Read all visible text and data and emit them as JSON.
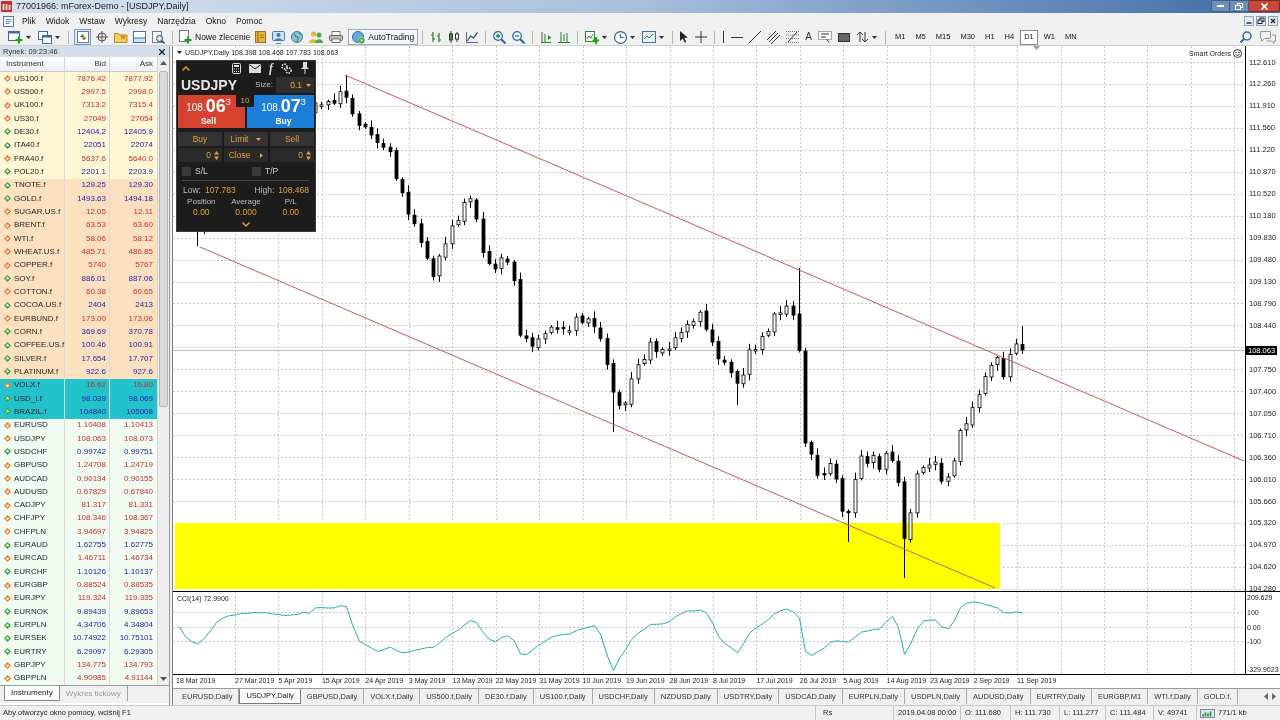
{
  "window": {
    "title": "77001966: mForex-Demo - [USDJPY,Daily]"
  },
  "menu": [
    "Plik",
    "Widok",
    "Wstaw",
    "Wykresy",
    "Narzędzia",
    "Okno",
    "Pomoc"
  ],
  "toolbar": {
    "view_toggles": [
      {
        "on": true
      },
      {
        "on": false
      },
      {
        "on": false
      },
      {
        "on": false
      },
      {
        "on": false
      }
    ],
    "new_order": "Nowe zlecenie",
    "autotrading": "AutoTrading",
    "text_tool": "A",
    "timeframes": [
      {
        "label": "M1",
        "selected": false
      },
      {
        "label": "M5",
        "selected": false
      },
      {
        "label": "M15",
        "selected": false
      },
      {
        "label": "M30",
        "selected": false
      },
      {
        "label": "H1",
        "selected": false
      },
      {
        "label": "H4",
        "selected": false
      },
      {
        "label": "D1",
        "selected": true
      },
      {
        "label": "W1",
        "selected": false
      },
      {
        "label": "MN",
        "selected": false
      }
    ]
  },
  "market_watch": {
    "title": "Rynek: 09:23:46",
    "columns": [
      "Instrument",
      "Bid",
      "Ask"
    ],
    "groups": [
      {
        "color": "#fff6d6",
        "rows": [
          {
            "symbol": "US100.f",
            "bid": "7876.42",
            "ask": "7877.92",
            "rising": false
          },
          {
            "symbol": "US500.f",
            "bid": "2997.5",
            "ask": "2998.0",
            "rising": false
          },
          {
            "symbol": "UK100.f",
            "bid": "7313.2",
            "ask": "7315.4",
            "rising": false
          },
          {
            "symbol": "US30.f",
            "bid": "27049",
            "ask": "27054",
            "rising": false
          },
          {
            "symbol": "DE30.f",
            "bid": "12404.2",
            "ask": "12405.9",
            "rising": true
          },
          {
            "symbol": "ITA40.f",
            "bid": "22051",
            "ask": "22074",
            "rising": true
          },
          {
            "symbol": "FRA40.f",
            "bid": "5637.6",
            "ask": "5640.0",
            "rising": false
          },
          {
            "symbol": "POL20.f",
            "bid": "2201.1",
            "ask": "2203.9",
            "rising": true
          }
        ]
      },
      {
        "color": "#fde0bf",
        "rows": [
          {
            "symbol": "TNOTE.f",
            "bid": "129.25",
            "ask": "129.30",
            "rising": true
          },
          {
            "symbol": "GOLD.f",
            "bid": "1493.63",
            "ask": "1494.18",
            "rising": true
          },
          {
            "symbol": "SUGAR.US.f",
            "bid": "12.05",
            "ask": "12.11",
            "rising": false
          },
          {
            "symbol": "BRENT.f",
            "bid": "63.53",
            "ask": "63.60",
            "rising": false
          },
          {
            "symbol": "WTI.f",
            "bid": "58.06",
            "ask": "58.12",
            "rising": false
          },
          {
            "symbol": "WHEAT.US.f",
            "bid": "485.71",
            "ask": "486.85",
            "rising": false
          },
          {
            "symbol": "COPPER.f",
            "bid": "5740",
            "ask": "5767",
            "rising": false
          },
          {
            "symbol": "SOY.f",
            "bid": "886.01",
            "ask": "887.06",
            "rising": true
          },
          {
            "symbol": "COTTON.f",
            "bid": "60.38",
            "ask": "60.65",
            "rising": false
          },
          {
            "symbol": "COCOA.US.f",
            "bid": "2404",
            "ask": "2413",
            "rising": true
          },
          {
            "symbol": "EURBUND.f",
            "bid": "173.00",
            "ask": "173.06",
            "rising": false
          },
          {
            "symbol": "CORN.f",
            "bid": "369.69",
            "ask": "370.78",
            "rising": true
          },
          {
            "symbol": "COFFEE.US.f",
            "bid": "100.46",
            "ask": "100.91",
            "rising": true
          },
          {
            "symbol": "SILVER.f",
            "bid": "17.654",
            "ask": "17.707",
            "rising": true
          },
          {
            "symbol": "PLATINUM.f",
            "bid": "922.6",
            "ask": "927.6",
            "rising": true
          }
        ]
      },
      {
        "color": "#22c3cb",
        "rows": [
          {
            "symbol": "VOLX.f",
            "bid": "16.62",
            "ask": "16.80",
            "rising": false
          },
          {
            "symbol": "USD_I.f",
            "bid": "98.039",
            "ask": "98.069",
            "rising": true
          },
          {
            "symbol": "BRAZIL.f",
            "bid": "104840",
            "ask": "105008",
            "rising": true
          }
        ]
      },
      {
        "color": "#f1fbf1",
        "rows": [
          {
            "symbol": "EURUSD",
            "bid": "1.10408",
            "ask": "1.10413",
            "rising": false
          },
          {
            "symbol": "USDJPY",
            "bid": "108.063",
            "ask": "108.073",
            "rising": false
          },
          {
            "symbol": "USDCHF",
            "bid": "0.99742",
            "ask": "0.99751",
            "rising": true
          },
          {
            "symbol": "GBPUSD",
            "bid": "1.24708",
            "ask": "1.24719",
            "rising": false
          },
          {
            "symbol": "AUDCAD",
            "bid": "0.90134",
            "ask": "0.90155",
            "rising": false
          },
          {
            "symbol": "AUDUSD",
            "bid": "0.67829",
            "ask": "0.67840",
            "rising": false
          },
          {
            "symbol": "CADJPY",
            "bid": "81.317",
            "ask": "81.331",
            "rising": false
          },
          {
            "symbol": "CHFJPY",
            "bid": "108.346",
            "ask": "108.367",
            "rising": false
          },
          {
            "symbol": "CHFPLN",
            "bid": "3.94697",
            "ask": "3.94825",
            "rising": false
          },
          {
            "symbol": "EURAUD",
            "bid": "1.62755",
            "ask": "1.62775",
            "rising": true
          },
          {
            "symbol": "EURCAD",
            "bid": "1.46711",
            "ask": "1.46734",
            "rising": false
          },
          {
            "symbol": "EURCHF",
            "bid": "1.10126",
            "ask": "1.10137",
            "rising": true
          },
          {
            "symbol": "EURGBP",
            "bid": "0.88524",
            "ask": "0.88535",
            "rising": false
          },
          {
            "symbol": "EURJPY",
            "bid": "119.324",
            "ask": "119.335",
            "rising": false
          },
          {
            "symbol": "EURNOK",
            "bid": "9.89439",
            "ask": "9.89653",
            "rising": true
          },
          {
            "symbol": "EURPLN",
            "bid": "4.34706",
            "ask": "4.34804",
            "rising": true
          },
          {
            "symbol": "EURSEK",
            "bid": "10.74922",
            "ask": "10.75101",
            "rising": true
          },
          {
            "symbol": "EURTRY",
            "bid": "6.29097",
            "ask": "6.29305",
            "rising": true
          },
          {
            "symbol": "GBPJPY",
            "bid": "134.775",
            "ask": "134.793",
            "rising": false
          },
          {
            "symbol": "GBPPLN",
            "bid": "4.90985",
            "ask": "4.91144",
            "rising": false
          }
        ]
      }
    ],
    "tabs": [
      {
        "label": "Instrumenty",
        "selected": true
      },
      {
        "label": "Wykres tickowy",
        "selected": false
      }
    ]
  },
  "chart": {
    "header": "USDJPY,Daily 108.398 108.468 107.783 108.063",
    "smart_orders": "Smart Orders",
    "price_axis": [
      "112.610",
      "112.260",
      "111.910",
      "111.560",
      "111.220",
      "110.870",
      "110.520",
      "110.180",
      "109.830",
      "109.480",
      "109.130",
      "108.790",
      "108.440",
      "107.750",
      "107.400",
      "107.050",
      "106.710",
      "106.360",
      "106.010",
      "105.660",
      "105.320",
      "104.970",
      "104.620",
      "104.280"
    ],
    "current_price": "108.063",
    "indicator": {
      "label": "CCI(14) 72.9900",
      "axis": [
        "209.629",
        "100",
        "0.00",
        "-100",
        "-329.9023"
      ]
    },
    "time_axis": [
      "18 Mar 2019",
      "27 Mar 2019",
      "5 Apr 2019",
      "15 Apr 2019",
      "24 Apr 2019",
      "3 May 2019",
      "13 May 2019",
      "22 May 2019",
      "31 May 2019",
      "10 Jun 2019",
      "19 Jun 2019",
      "28 Jun 2019",
      "8 Jul 2019",
      "17 Jul 2019",
      "26 Jul 2019",
      "5 Aug 2019",
      "14 Aug 2019",
      "23 Aug 2019",
      "2 Sep 2019",
      "11 Sep 2019"
    ],
    "trade_panel": {
      "function_label": "f",
      "symbol": "USDJPY",
      "size_label": "Size:",
      "size": "0.1",
      "sell": {
        "prefix": "108.",
        "big": "06",
        "sup": "3",
        "label": "Sell"
      },
      "buy": {
        "prefix": "108.",
        "big": "07",
        "sup": "3",
        "label": "Buy"
      },
      "spread": "10",
      "buy_button": "Buy",
      "order_type": "Limit",
      "sell_button": "Sell",
      "buy_volume": "0",
      "close_button": "Close",
      "sell_volume": "0",
      "stop_loss": {
        "label": "S/L",
        "checked": false
      },
      "take_profit": {
        "label": "T/P",
        "checked": false
      },
      "low_label": "Low:",
      "low": "107.783",
      "high_label": "High:",
      "high": "108.468",
      "stats": [
        {
          "label": "Position",
          "value": "0.00"
        },
        {
          "label": "Average",
          "value": "0.000"
        },
        {
          "label": "P/L",
          "value": "0.00"
        }
      ]
    }
  },
  "chart_tabs": [
    {
      "label": "EURUSD,Daily",
      "selected": false
    },
    {
      "label": "USDJPY,Daily",
      "selected": true
    },
    {
      "label": "GBPUSD,Daily",
      "selected": false
    },
    {
      "label": "VOLX.f,Daily",
      "selected": false
    },
    {
      "label": "US500.f,Daily",
      "selected": false
    },
    {
      "label": "DE30.f,Daily",
      "selected": false
    },
    {
      "label": "US100.f,Daily",
      "selected": false
    },
    {
      "label": "USDCHF,Daily",
      "selected": false
    },
    {
      "label": "NZDUSD,Daily",
      "selected": false
    },
    {
      "label": "USDTRY,Daily",
      "selected": false
    },
    {
      "label": "USDCAD,Daily",
      "selected": false
    },
    {
      "label": "EURPLN,Daily",
      "selected": false
    },
    {
      "label": "USDPLN,Daily",
      "selected": false
    },
    {
      "label": "AUDUSD,Daily",
      "selected": false
    },
    {
      "label": "EURTRY,Daily",
      "selected": false
    },
    {
      "label": "EURGBP,M1",
      "selected": false
    },
    {
      "label": "WTI.f,Daily",
      "selected": false
    },
    {
      "label": "GOLD.f,",
      "selected": false
    }
  ],
  "status_bar": {
    "help": "Aby otworzyć okno pomocy, wciśnij F1",
    "profile": "Rs",
    "date": "2019.04.08 00:00",
    "open": "O: 111.680",
    "high": "H: 111.730",
    "low": "L: 111.277",
    "close": "C: 111.484",
    "volume": "V: 49741",
    "traffic": "771/1 kb"
  }
}
